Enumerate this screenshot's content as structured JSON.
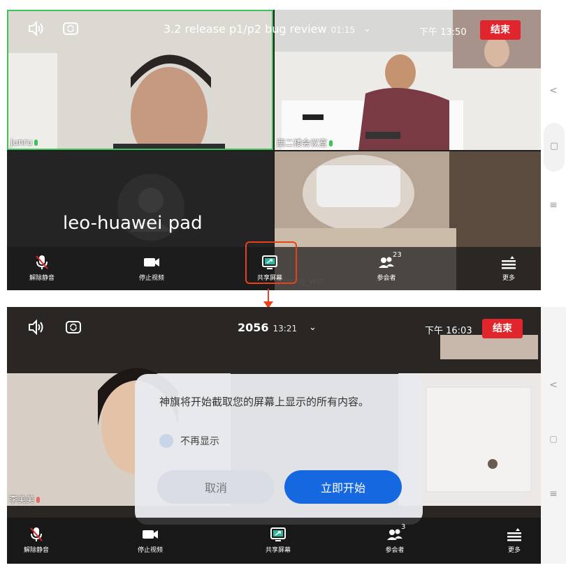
{
  "screen1": {
    "title": "3.2 release p1/p2 bug review",
    "duration": "01:15",
    "clock": "下午 13:50",
    "end_label": "结束",
    "tiles": {
      "junru": "junru",
      "room": "西二楼会议室",
      "leo": "leo-huawei pad",
      "yiming": "yiming_win"
    },
    "toolbar": {
      "unmute": "解除静音",
      "stop_video": "停止视频",
      "share": "共享屏幕",
      "participants": "参会者",
      "participants_count": "23",
      "more": "更多"
    }
  },
  "screen2": {
    "title": "2056",
    "duration": "13:21",
    "clock": "下午 16:03",
    "end_label": "结束",
    "participant_name": "李美美",
    "dialog": {
      "message": "神旗将开始截取您的屏幕上显示的所有内容。",
      "dont_show": "不再显示",
      "cancel": "取消",
      "start": "立即开始"
    },
    "toolbar": {
      "unmute": "解除静音",
      "stop_video": "停止视频",
      "share": "共享屏幕",
      "participants": "参会者",
      "participants_count": "3",
      "more": "更多"
    }
  },
  "side_nav": {
    "back": "<",
    "home": "▢",
    "menu": "≡"
  },
  "colors": {
    "end_red": "#e0252d",
    "highlight": "#e8421a",
    "primary_blue": "#1668e0",
    "active_speaker": "#3ec35b"
  },
  "icons": [
    "speaker-icon",
    "camera-switch-icon",
    "chevron-down-icon",
    "mic-muted-icon",
    "video-icon",
    "share-screen-icon",
    "participants-icon",
    "more-icon",
    "arrow-down-icon"
  ]
}
